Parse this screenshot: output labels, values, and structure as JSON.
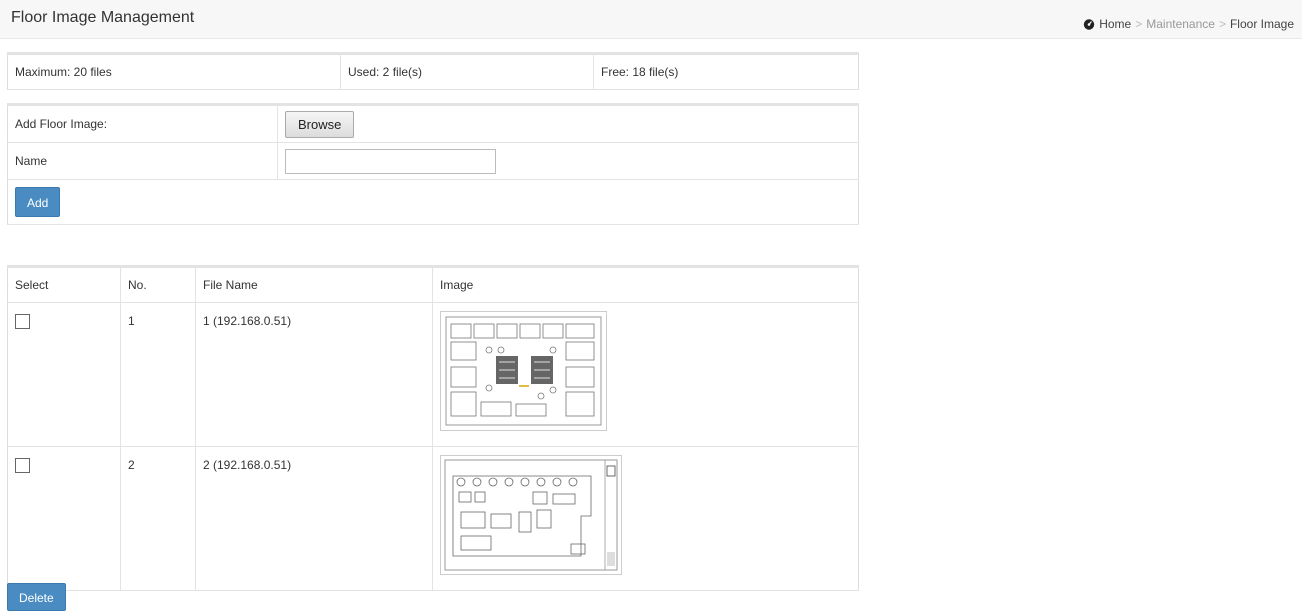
{
  "header": {
    "title": "Floor Image Management",
    "breadcrumb": [
      "Home",
      "Maintenance",
      "Floor Image"
    ],
    "separator": ">"
  },
  "info": {
    "maximum": "Maximum: 20 files",
    "used": "Used: 2 file(s)",
    "free": "Free: 18 file(s)"
  },
  "add_form": {
    "add_label": "Add Floor Image:",
    "browse_label": "Browse",
    "name_label": "Name",
    "name_value": "",
    "add_button": "Add"
  },
  "table": {
    "headers": [
      "Select",
      "No.",
      "File Name",
      "Image"
    ],
    "rows": [
      {
        "no": "1",
        "file_name": "1 (192.168.0.51)",
        "selected": false,
        "image": "floor-plan-thumbnail"
      },
      {
        "no": "2",
        "file_name": "2 (192.168.0.51)",
        "selected": false,
        "image": "floor-plan-thumbnail"
      }
    ]
  },
  "delete_button": "Delete",
  "icons": {
    "home": "dashboard-icon"
  },
  "colors": {
    "accent": "#4a8cc2",
    "header_bg": "#f7f7f7"
  }
}
